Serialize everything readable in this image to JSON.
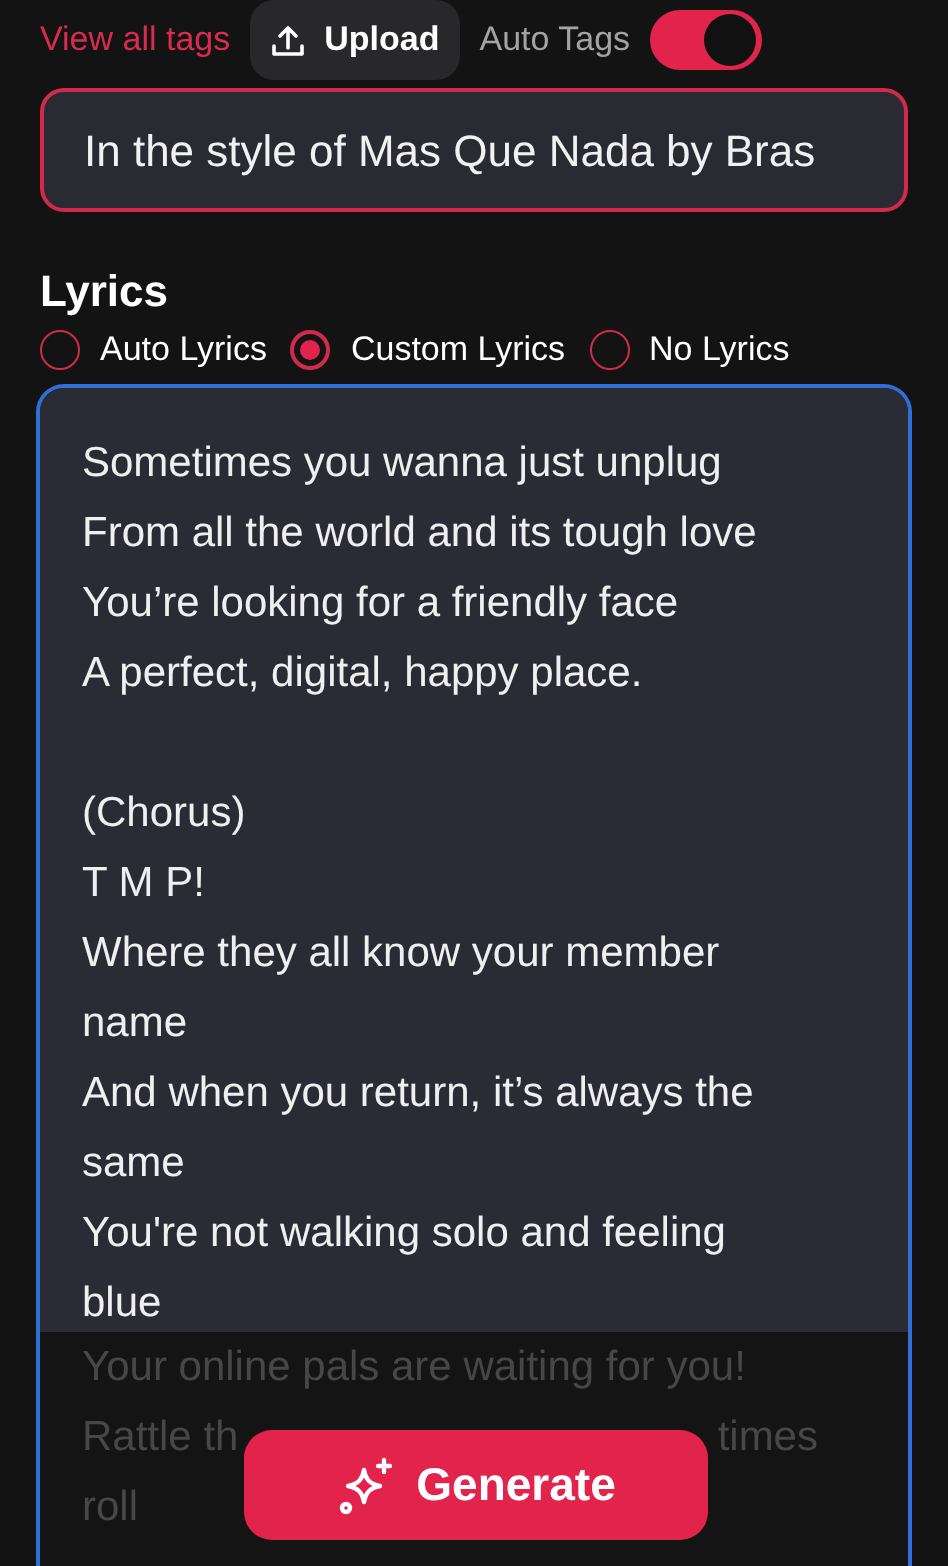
{
  "top_bar": {
    "view_all_link": "View all tags",
    "upload_button": "Upload",
    "auto_tags": {
      "label": "Auto Tags",
      "on": true
    }
  },
  "style_field": {
    "value": "In the style of Mas Que Nada by Bras"
  },
  "lyrics": {
    "heading": "Lyrics",
    "options": [
      {
        "label": "Auto Lyrics",
        "selected": false
      },
      {
        "label": "Custom Lyrics",
        "selected": true
      },
      {
        "label": "No Lyrics",
        "selected": false
      }
    ],
    "stanzas": [
      [
        "Sometimes you wanna just unplug",
        "From all the world and its tough love",
        "You’re looking for a friendly face",
        "A perfect, digital, happy place."
      ],
      [
        "(Chorus)",
        "T M P!",
        "Where they all know your member",
        "name",
        "And when you return, it’s always the",
        "same",
        "You're not walking solo and feeling",
        "blue"
      ]
    ],
    "faded_lines": [
      [
        "Your online pals are waiting for you!"
      ],
      [
        "Rattle th",
        "times"
      ],
      [
        "roll"
      ]
    ]
  },
  "generate_button": "Generate"
}
